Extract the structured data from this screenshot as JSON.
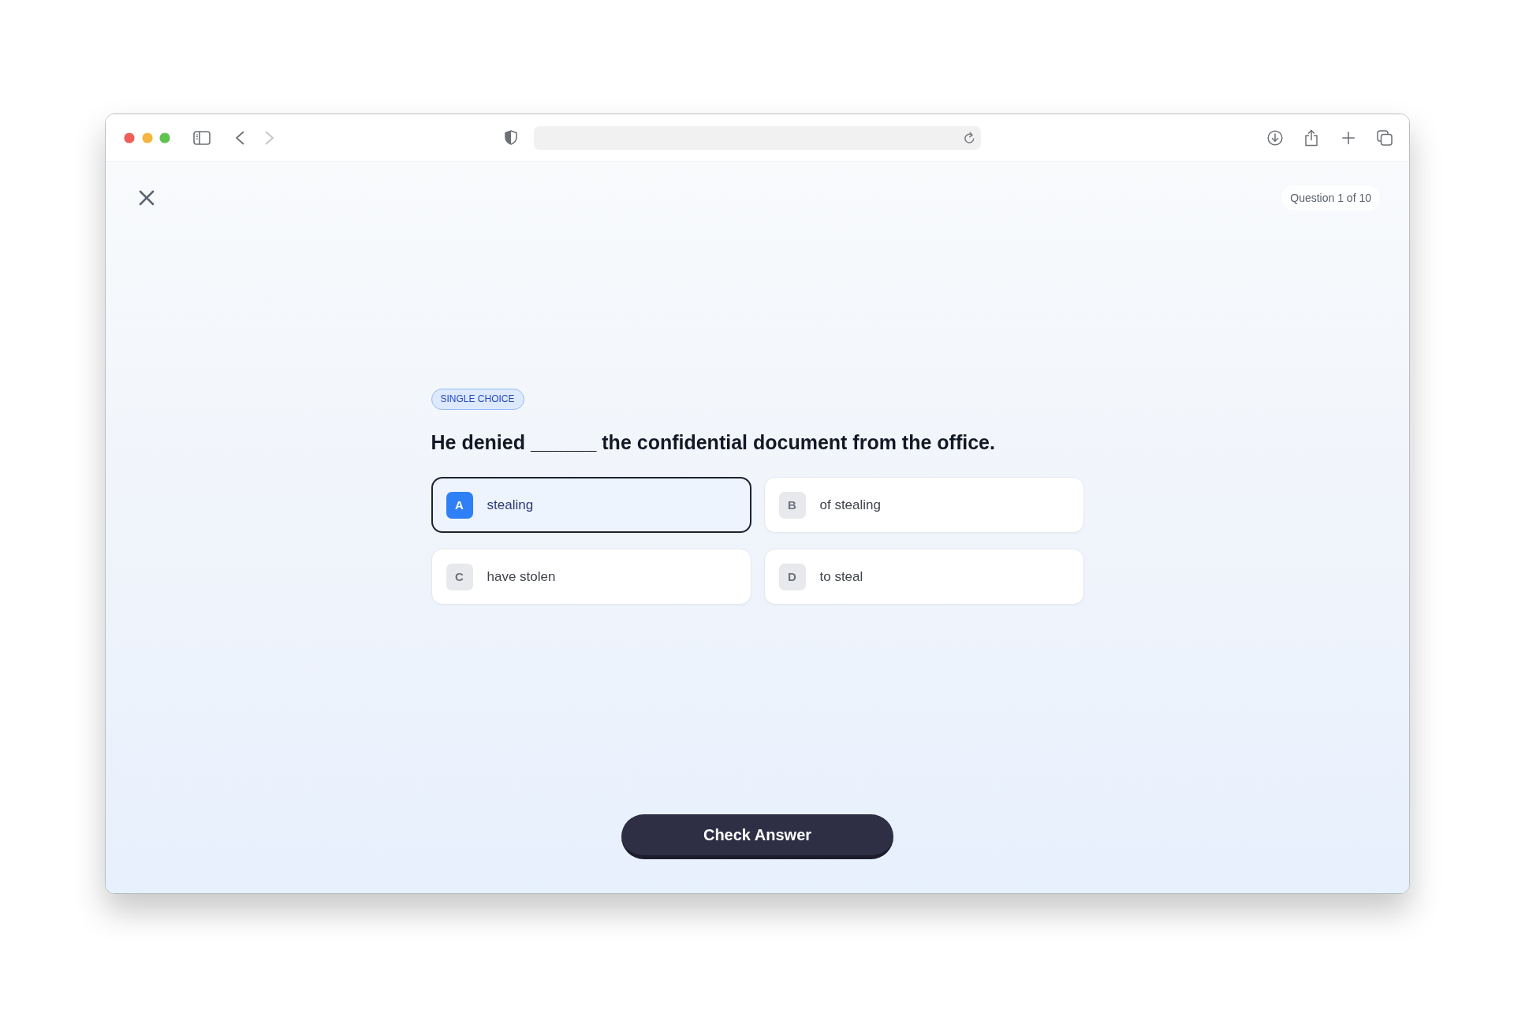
{
  "browser": {
    "back_button": {
      "disabled": false
    },
    "forward_button": {
      "disabled": true
    }
  },
  "quiz": {
    "progress": "Question 1 of 10",
    "question_type": "SINGLE CHOICE",
    "question": "He denied ______ the confidential document from the office.",
    "options": [
      {
        "letter": "A",
        "text": "stealing",
        "selected": true
      },
      {
        "letter": "B",
        "text": "of stealing",
        "selected": false
      },
      {
        "letter": "C",
        "text": "have stolen",
        "selected": false
      },
      {
        "letter": "D",
        "text": "to steal",
        "selected": false
      }
    ],
    "submit_button": "Check Answer"
  }
}
